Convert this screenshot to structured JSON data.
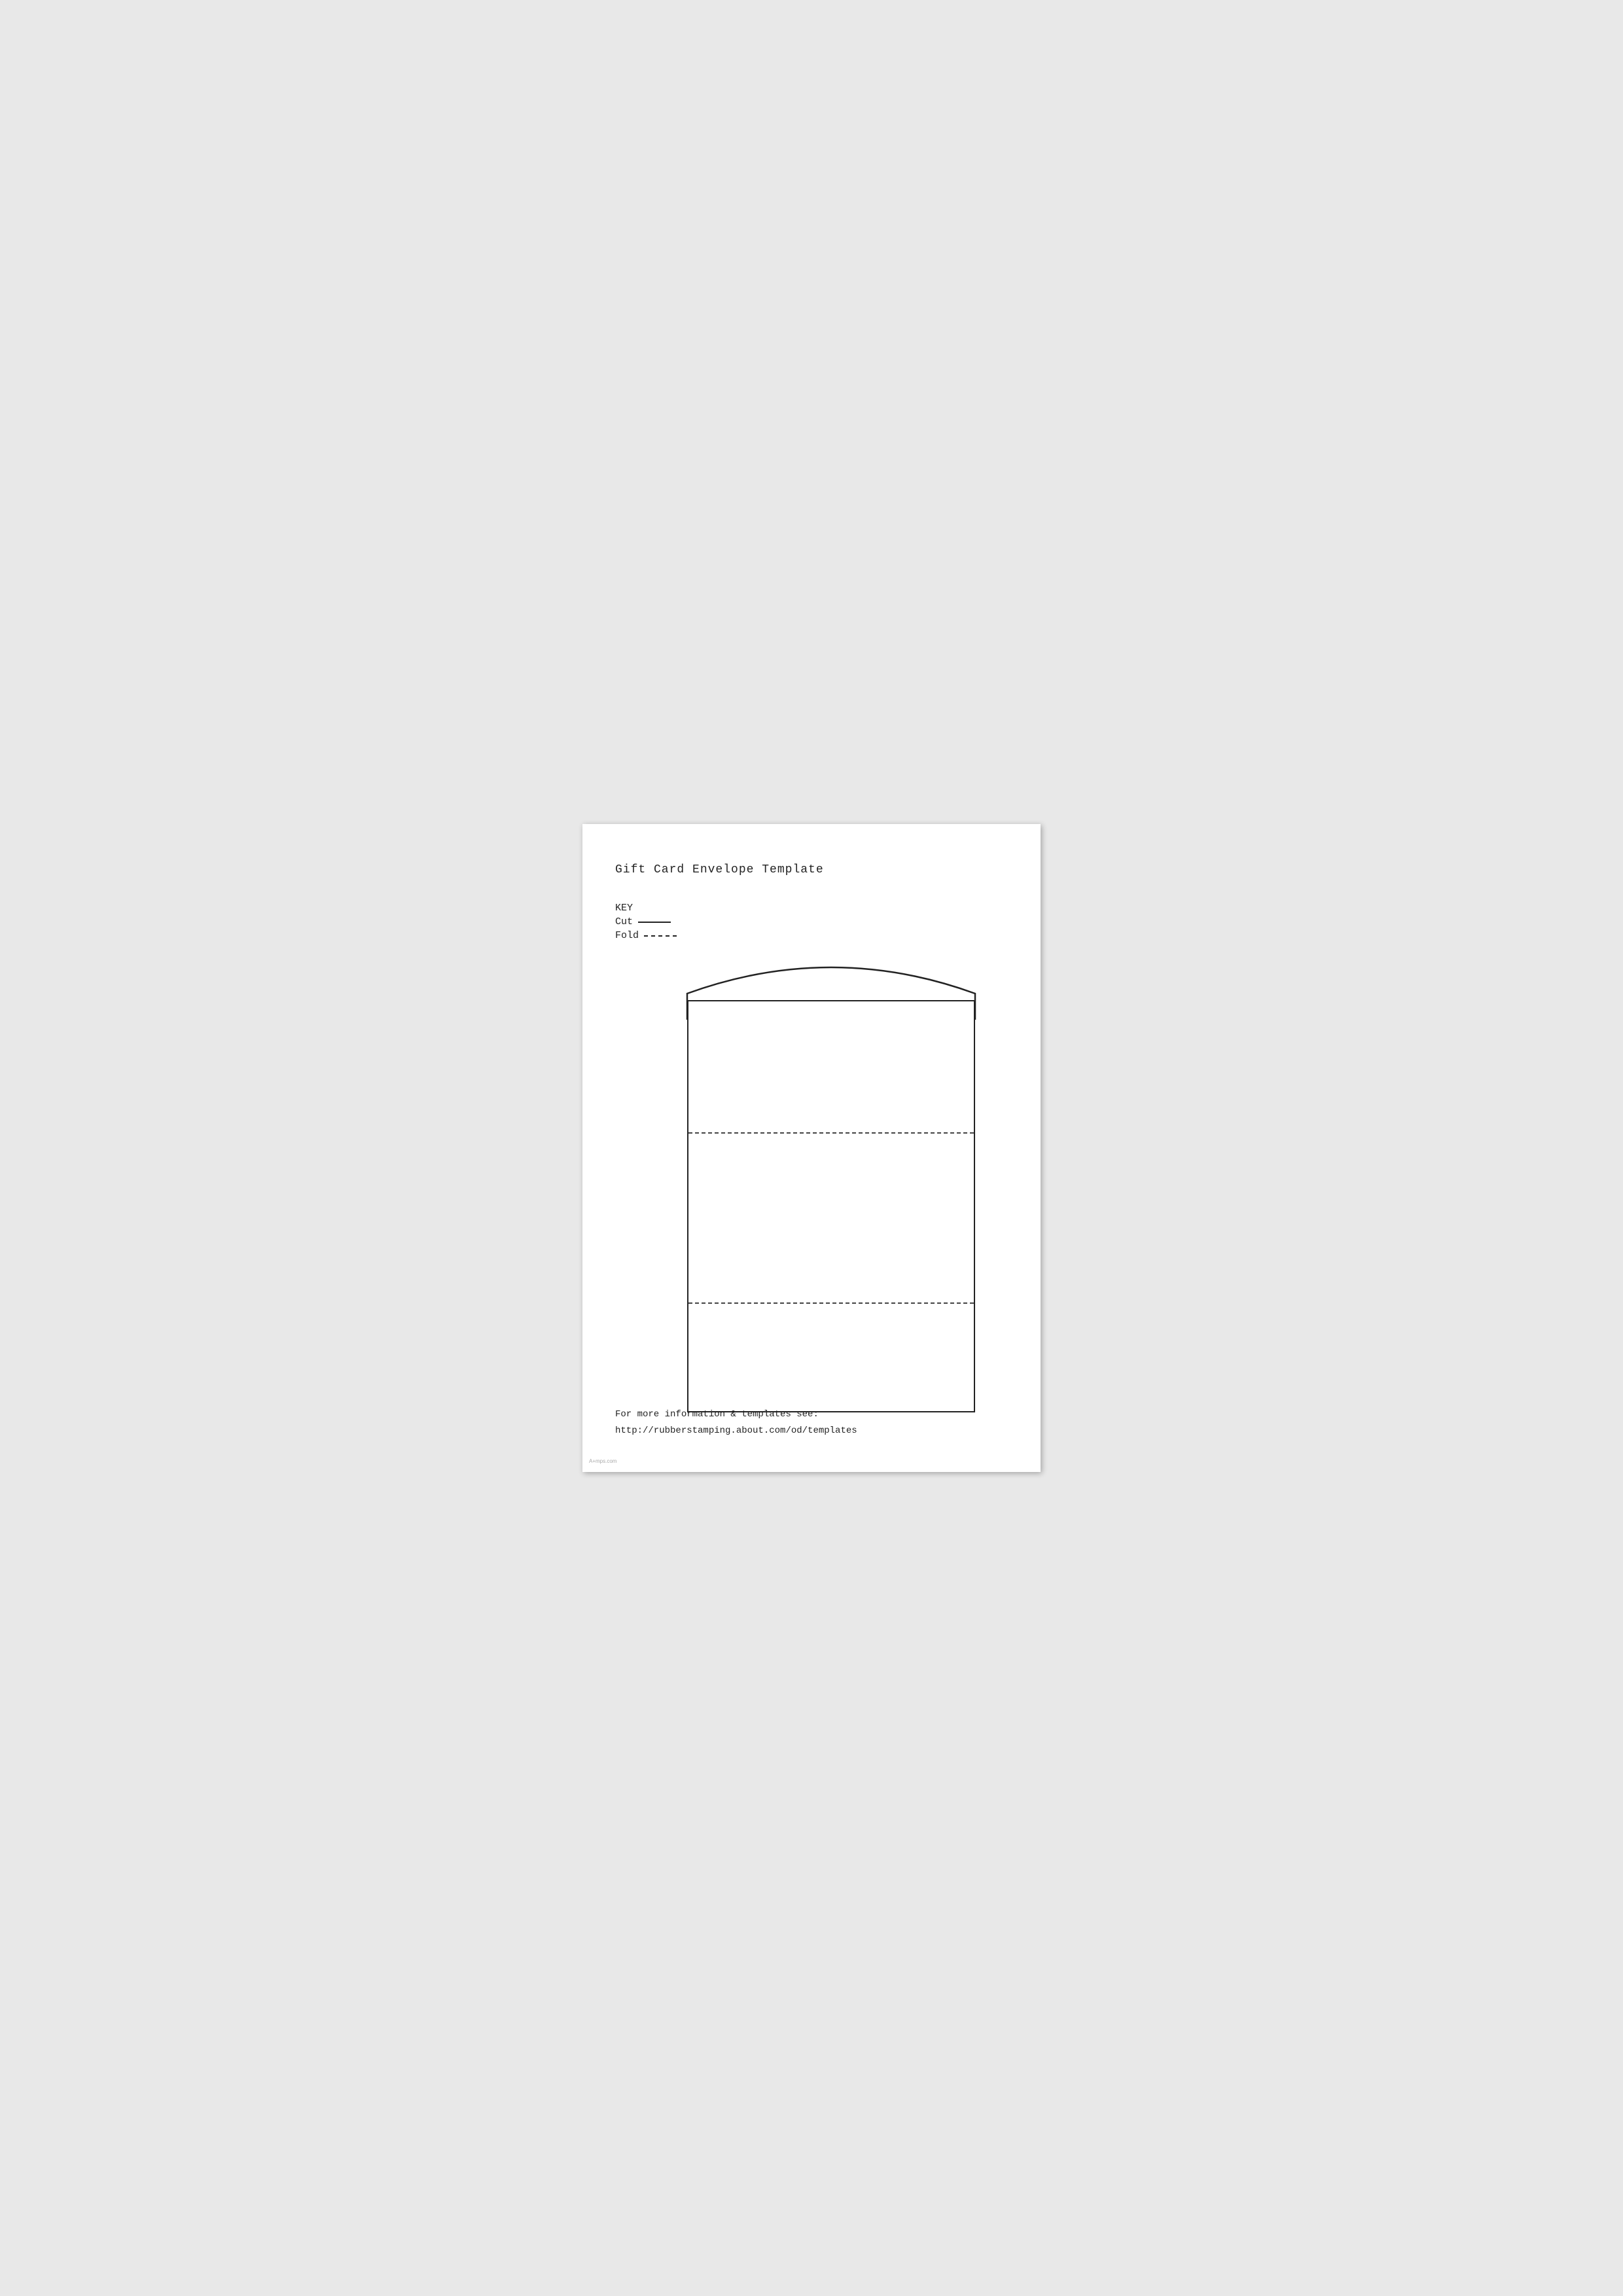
{
  "page": {
    "title": "Gift Card Envelope Template",
    "key": {
      "label": "KEY",
      "cut_label": "Cut",
      "fold_label": "Fold"
    },
    "footer": {
      "line1": "For more information & templates see:",
      "line2": "http://rubberstamping.about.com/od/templates"
    },
    "watermark": "A+mps.com"
  }
}
